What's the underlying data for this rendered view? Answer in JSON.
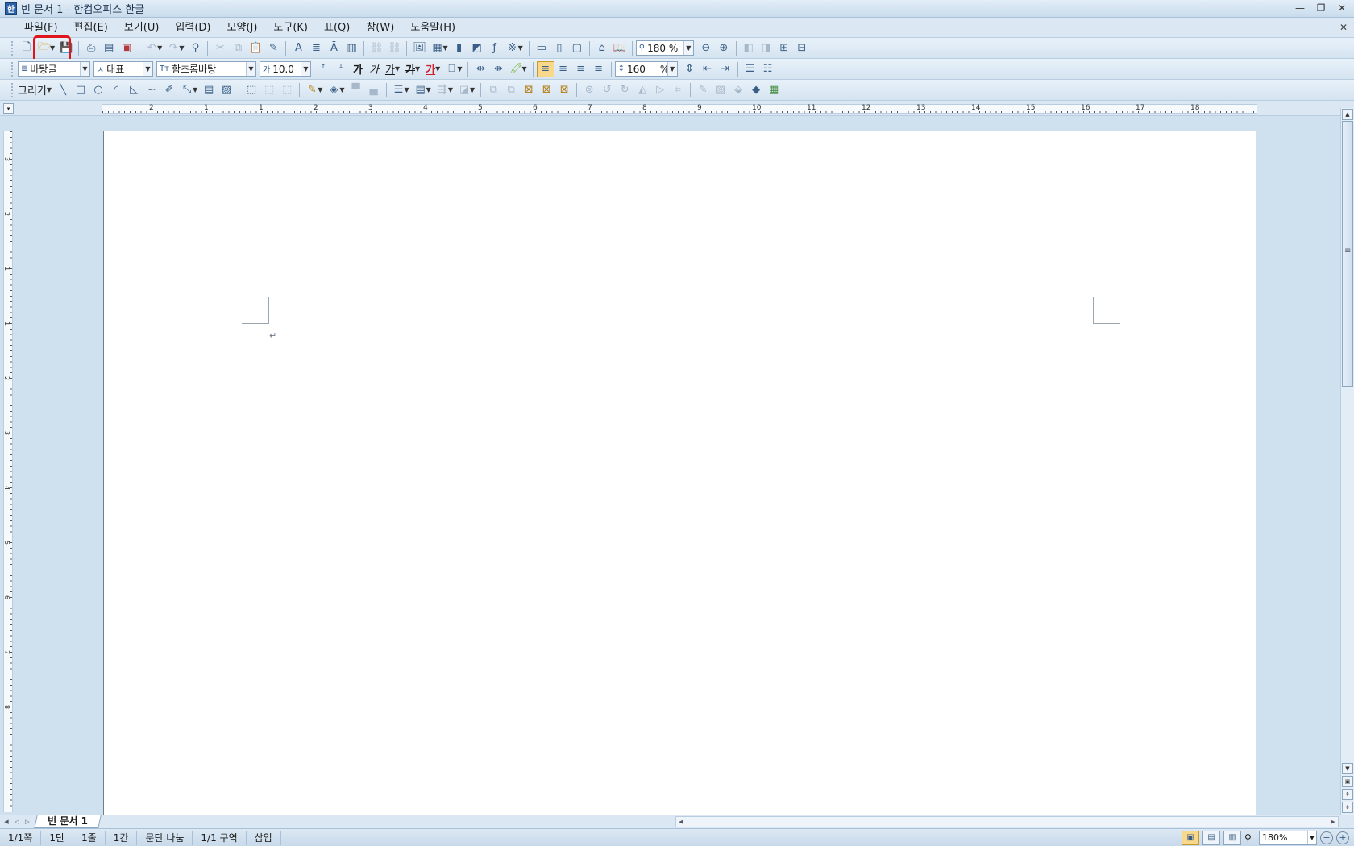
{
  "window": {
    "title": "빈 문서 1 - 한컴오피스 한글",
    "app_icon": "한"
  },
  "menu": [
    {
      "label": "파일(F)"
    },
    {
      "label": "편집(E)"
    },
    {
      "label": "보기(U)"
    },
    {
      "label": "입력(D)"
    },
    {
      "label": "모양(J)"
    },
    {
      "label": "도구(K)"
    },
    {
      "label": "표(Q)"
    },
    {
      "label": "창(W)"
    },
    {
      "label": "도움말(H)"
    }
  ],
  "toolbar": {
    "zoom_value": "180 %",
    "style_value": "바탕글",
    "lang_value": "대표",
    "font_value": "함초롬바탕",
    "font_size_value": "10.0",
    "line_spacing_value": "160",
    "line_spacing_unit": "%",
    "draw_label": "그리기",
    "bold_glyph": "가",
    "italic_glyph": "가",
    "underline_glyph": "가",
    "strike_glyph": "가",
    "color_glyph": "가",
    "highlight_color": "#e0151b"
  },
  "ruler": {
    "h_labels": [
      "2",
      "1",
      "1",
      "2",
      "3",
      "4",
      "5",
      "6",
      "7",
      "8",
      "9",
      "10",
      "11",
      "12",
      "13",
      "14",
      "15",
      "16",
      "17",
      "18"
    ],
    "v_labels": [
      "3",
      "2",
      "1",
      "1",
      "2",
      "3",
      "4",
      "5",
      "6",
      "7",
      "8"
    ]
  },
  "tabs": [
    {
      "label": "빈 문서 1"
    }
  ],
  "status": {
    "page": "1/1쪽",
    "column": "1단",
    "line": "1줄",
    "col_pos": "1칸",
    "paragraph": "문단 나눔",
    "section": "1/1 구역",
    "mode": "삽입",
    "zoom": "180%"
  },
  "colors": {
    "window_bg": "#cfe0ef",
    "highlight": "#e0151b",
    "accent": "#2b62a8"
  }
}
